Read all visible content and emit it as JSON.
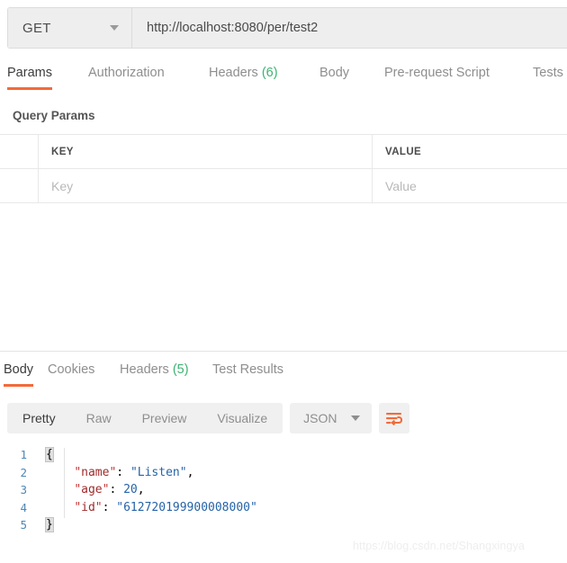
{
  "request": {
    "method": "GET",
    "url": "http://localhost:8080/per/test2",
    "url_placeholder": "Enter request URL",
    "tabs": [
      {
        "label": "Params",
        "count": "",
        "active": true
      },
      {
        "label": "Authorization",
        "count": "",
        "active": false
      },
      {
        "label": "Headers",
        "count": "(6)",
        "active": false
      },
      {
        "label": "Body",
        "count": "",
        "active": false
      },
      {
        "label": "Pre-request Script",
        "count": "",
        "active": false
      },
      {
        "label": "Tests",
        "count": "",
        "active": false
      }
    ],
    "params": {
      "section_title": "Query Params",
      "columns": [
        "KEY",
        "VALUE"
      ],
      "rows": [
        {
          "key_placeholder": "Key",
          "value_placeholder": "Value"
        }
      ]
    }
  },
  "response": {
    "tabs": [
      {
        "label": "Body",
        "count": "",
        "active": true
      },
      {
        "label": "Cookies",
        "count": "",
        "active": false
      },
      {
        "label": "Headers",
        "count": "(5)",
        "active": false
      },
      {
        "label": "Test Results",
        "count": "",
        "active": false
      }
    ],
    "view_modes": [
      {
        "label": "Pretty",
        "active": true
      },
      {
        "label": "Raw",
        "active": false
      },
      {
        "label": "Preview",
        "active": false
      },
      {
        "label": "Visualize",
        "active": false
      }
    ],
    "format": "JSON",
    "wrap_icon": "word-wrap-icon",
    "body": {
      "line_numbers": [
        "1",
        "2",
        "3",
        "4",
        "5"
      ],
      "lines": [
        {
          "open_brace": "{"
        },
        {
          "key": "name",
          "value": "\"Listen\"",
          "comma": ","
        },
        {
          "key": "age",
          "value": "20",
          "comma": ","
        },
        {
          "key": "id",
          "value": "\"612720199900008000\"",
          "comma": ""
        },
        {
          "close_brace": "}"
        }
      ]
    }
  },
  "watermark": "https://blog.csdn.net/Shangxingya",
  "colors": {
    "accent": "#f26b3a",
    "count_green": "#3cb371",
    "json_key": "#9e2a2a",
    "json_string": "#2563a8",
    "line_number": "#4d87b5"
  }
}
